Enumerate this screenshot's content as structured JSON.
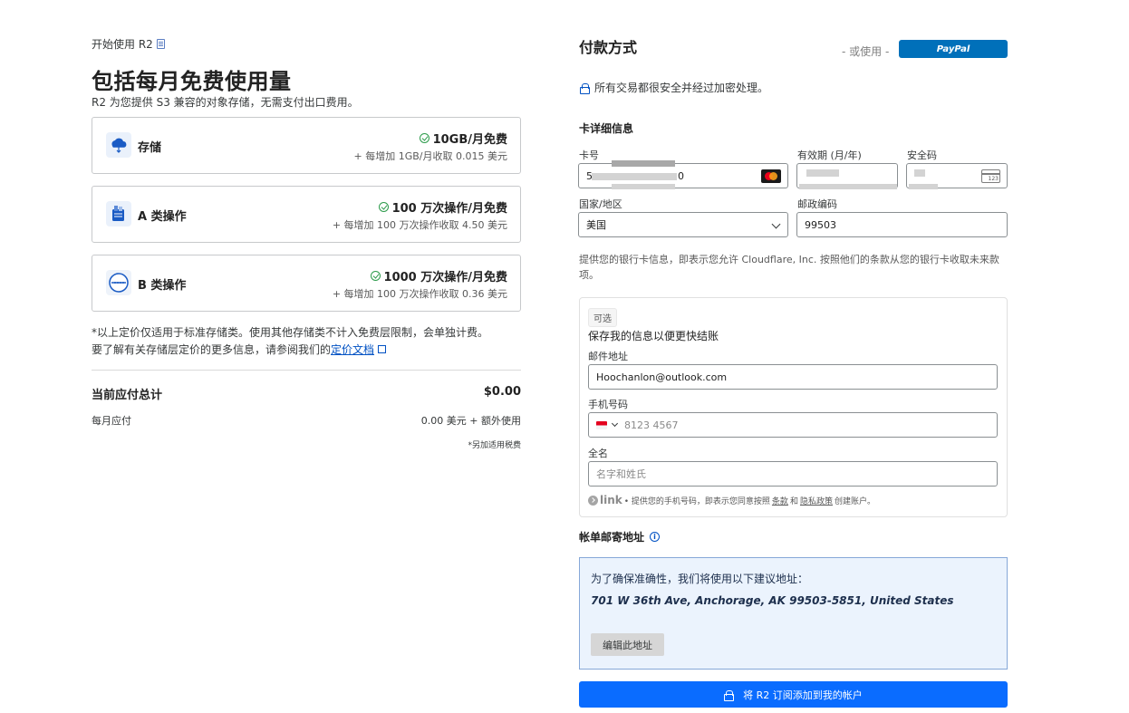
{
  "left": {
    "breadcrumb": "开始使用 R2",
    "title": "包括每月免费使用量",
    "subtitle": "R2 为您提供 S3 兼容的对象存储，无需支付出口费用。",
    "cards": [
      {
        "name": "存储",
        "free": "10GB/月免费",
        "extra": "+ 每增加 1GB/月收取 0.015 美元",
        "icon": "cloud-storage-icon"
      },
      {
        "name": "A 类操作",
        "free": "100 万次操作/月免费",
        "extra": "+ 每增加 100 万次操作收取 4.50 美元",
        "icon": "class-a-operations-icon"
      },
      {
        "name": "B 类操作",
        "free": "1000 万次操作/月免费",
        "extra": "+ 每增加 100 万次操作收取 0.36 美元",
        "icon": "class-b-operations-icon"
      }
    ],
    "note_line1": "*以上定价仅适用于标准存储类。使用其他存储类不计入免费层限制，会单独计费。",
    "note_line2": "要了解有关存储层定价的更多信息，请参阅我们的",
    "note_link": "定价文档",
    "total_label": "当前应付总计",
    "total_value": "$0.00",
    "monthly_label": "每月应付",
    "monthly_value": "0.00 美元 + 额外使用",
    "tax_note": "*另加适用税费"
  },
  "payment": {
    "title": "付款方式",
    "or_use": "- 或使用 -",
    "paypal": "PayPal",
    "secure_note": "所有交易都很安全并经过加密处理。",
    "card_details": "卡详细信息",
    "card_number_label": "卡号",
    "card_number_prefix": "5",
    "card_number_suffix": "0",
    "expiry_label": "有效期 (月/年)",
    "cvc_label": "安全码",
    "cvc_icon_text": "123",
    "country_label": "国家/地区",
    "country_value": "美国",
    "zip_label": "邮政编码",
    "zip_value": "99503",
    "consent": "提供您的银行卡信息，即表示您允许 Cloudflare, Inc. 按照他们的条款从您的银行卡收取未来款项。"
  },
  "link": {
    "optional_badge": "可选",
    "heading": "保存我的信息以便更快结账",
    "email_label": "邮件地址",
    "email_value": "Hoochanlon@outlook.com",
    "phone_label": "手机号码",
    "phone_placeholder": "8123 4567",
    "name_label": "全名",
    "name_placeholder": "名字和姓氏",
    "logo": "link",
    "foot_part1": "• 提供您的手机号码，即表示您同意按照",
    "foot_terms": "条款",
    "foot_and": "和",
    "foot_privacy": "隐私政策",
    "foot_part2": "创建账户。"
  },
  "billing": {
    "title": "帐单邮寄地址",
    "suggest_text": "为了确保准确性，我们将使用以下建议地址：",
    "address": "701 W 36th Ave, Anchorage, AK 99503-5851, United States",
    "edit_button": "编辑此地址"
  },
  "submit_button": "将 R2 订阅添加到我的帐户",
  "colors": {
    "primary": "#0a6cff",
    "paypal": "#0070ba",
    "success": "#2c9b4b",
    "link": "#0051c3",
    "address_bg": "#ebf3fd"
  }
}
